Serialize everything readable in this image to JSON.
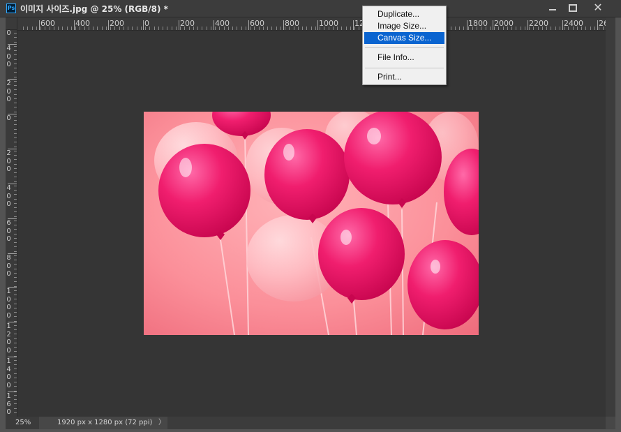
{
  "window": {
    "app_icon": "Ps",
    "title": "이미지 사이즈.jpg @ 25% (RGB/8) *"
  },
  "ruler": {
    "top_labels": [
      "600",
      "400",
      "200",
      "0",
      "200",
      "400",
      "600",
      "800",
      "1000",
      "12",
      "1800",
      "2000",
      "2200",
      "2400",
      "26"
    ],
    "left_labels": [
      "0",
      "4\n0\n0",
      "2\n0\n0",
      "0",
      "2\n0\n0",
      "4\n0\n0",
      "6\n0\n0",
      "8\n0\n0",
      "1\n0\n0\n0",
      "1\n2\n0\n0",
      "1\n4\n0\n0",
      "1\n6\n0\n0"
    ]
  },
  "menu": {
    "items": [
      {
        "label": "Duplicate...",
        "selected": false
      },
      {
        "label": "Image Size...",
        "selected": false
      },
      {
        "label": "Canvas Size...",
        "selected": true
      },
      {
        "label": "File Info...",
        "selected": false
      },
      {
        "label": "Print...",
        "selected": false
      }
    ]
  },
  "status": {
    "zoom": "25%",
    "doc_info": "1920 px x 1280 px (72 ppi)",
    "arrow": "〉"
  },
  "colors": {
    "accent": "#0a64d0",
    "balloon_magenta": "#e8135f",
    "photo_background": "#f88a95"
  }
}
